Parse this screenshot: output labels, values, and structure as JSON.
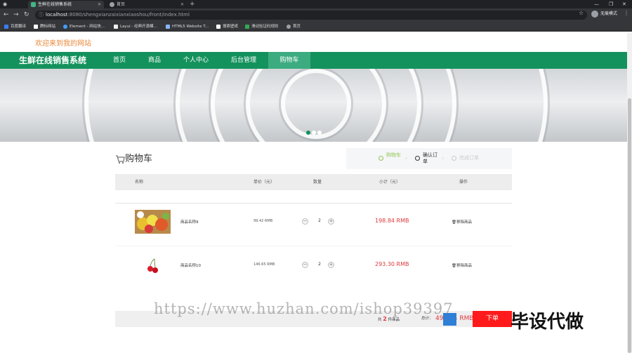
{
  "browser": {
    "tabs": [
      {
        "title": "生鲜在线销售系统",
        "favicon_color": "#41b883"
      },
      {
        "title": "首页",
        "favicon_color": "#9aa0a6"
      }
    ],
    "url_host": "localhost",
    "url_rest": ":8080/shengxianzaixianxiaoshou/front/index.html",
    "profile_label": "无痕模式",
    "bookmarks": [
      {
        "label": "百度翻译",
        "color": "#3b7ded"
      },
      {
        "label": "腾标网站",
        "color": "#ffffff"
      },
      {
        "label": "Element - 网站快...",
        "color": "#409eff"
      },
      {
        "label": "Layui - 经典开源模...",
        "color": "#eeeeee"
      },
      {
        "label": "HTML5 Website T...",
        "color": "#8ab4f8"
      },
      {
        "label": "搜索壁纸",
        "color": "#ffffff"
      },
      {
        "label": "滑动验证码规则",
        "color": "#34a853"
      },
      {
        "label": "首页",
        "color": "#9aa0a6"
      }
    ]
  },
  "site": {
    "welcome": "欢迎来到我的网站",
    "brand": "生鲜在线销售系统",
    "nav": [
      "首页",
      "商品",
      "个人中心",
      "后台管理",
      "购物车"
    ],
    "nav_active": 4,
    "accent": "#14925d"
  },
  "cart": {
    "title": "购物车",
    "steps": [
      "购物车",
      "确认订单",
      "完成订单"
    ],
    "headers": {
      "name": "名称",
      "price": "单价（元）",
      "qty": "数量",
      "subtotal": "小计（元）",
      "action": "操作"
    },
    "items": [
      {
        "name": "商品名称9",
        "price": "99.42 RMB",
        "qty": "2",
        "subtotal": "198.84 RMB",
        "remove": "移除商品"
      },
      {
        "name": "商品名称10",
        "price": "146.65 RMB",
        "qty": "2",
        "subtotal": "293.30 RMB",
        "remove": "移除商品"
      }
    ],
    "footer": {
      "count_prefix": "共",
      "count": "2",
      "count_suffix": "件商品",
      "total_label": "总计：",
      "total": "492.14 RMB",
      "order_button": "下单"
    }
  },
  "watermark": {
    "url": "https://www.huzhan.com/ishop39397",
    "text": "毕设代做"
  }
}
